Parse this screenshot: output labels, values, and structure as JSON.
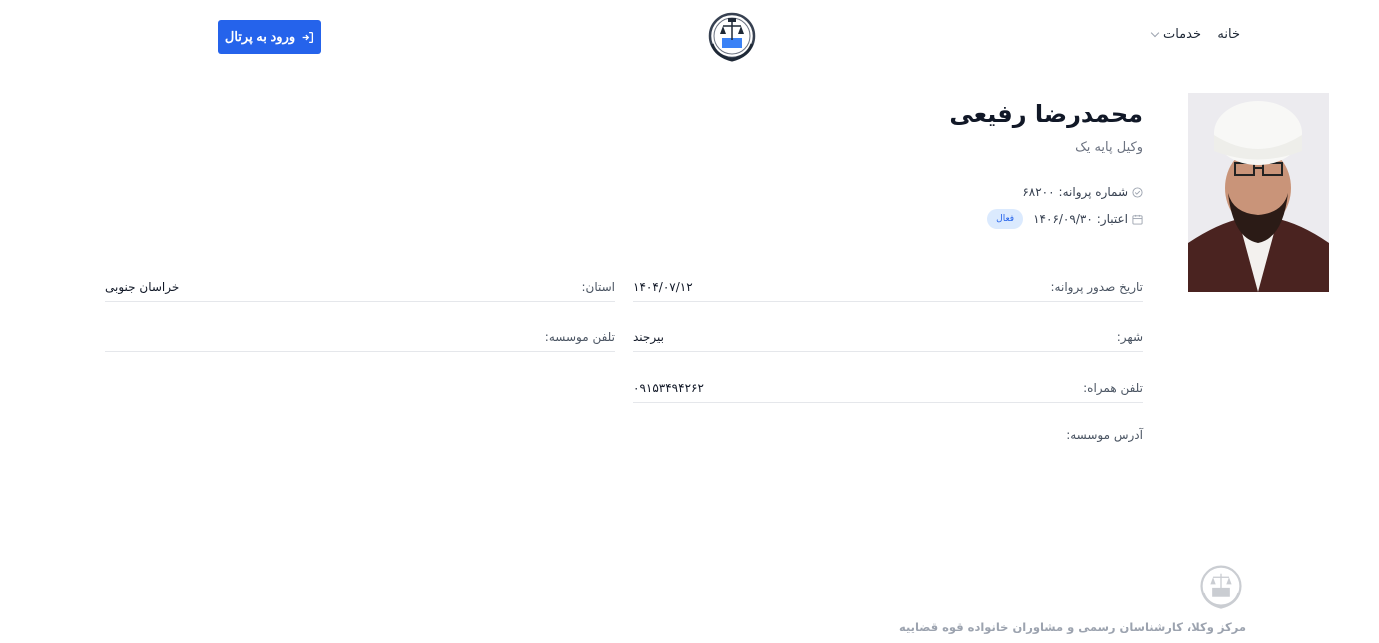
{
  "header": {
    "home_label": "خانه",
    "services_label": "خدمات",
    "portal_button_label": "ورود به پرتال"
  },
  "profile": {
    "name": "محمدرضا رفیعی",
    "rank": "وکیل پایه یک",
    "license_label": "شماره پروانه:",
    "license_number": "۶۸۲۰۰",
    "validity_label": "اعتبار:",
    "validity_date": "۱۴۰۶/۰۹/۳۰",
    "status": "فعال"
  },
  "details": {
    "issue_date_label": "تاریخ صدور پروانه:",
    "issue_date": "۱۴۰۴/۰۷/۱۲",
    "province_label": "استان:",
    "province": "خراسان جنوبی",
    "city_label": "شهر:",
    "city": "بیرجند",
    "office_phone_label": "تلفن موسسه:",
    "office_phone": "",
    "mobile_label": "تلفن همراه:",
    "mobile": "۰۹۱۵۳۴۹۴۲۶۲",
    "address_label": "آدرس موسسه:"
  },
  "footer": {
    "text": "مرکز وکلا، کارشناسان رسمی و مشاوران خانواده قوه قضاییه"
  },
  "colors": {
    "primary": "#2563eb",
    "badge_bg": "#dbeafe"
  }
}
